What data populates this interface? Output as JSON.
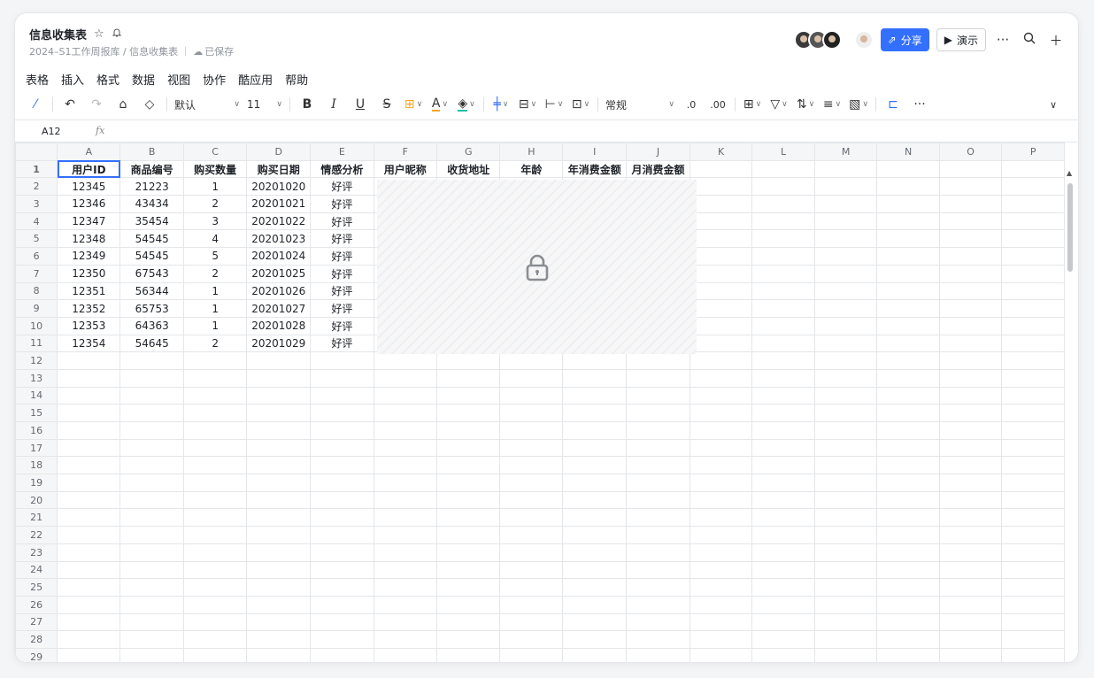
{
  "doc": {
    "title": "信息收集表",
    "breadcrumb": "2024–S1工作周报库 / 信息收集表",
    "save_status": "已保存"
  },
  "header": {
    "share_label": "分享",
    "demo_label": "演示",
    "more": "···"
  },
  "menu": [
    "表格",
    "插入",
    "格式",
    "数据",
    "视图",
    "协作",
    "酷应用",
    "帮助"
  ],
  "toolbar": {
    "font": "默认",
    "size": "11",
    "format": "常规",
    "more": "···"
  },
  "formula": {
    "cell_ref": "A12",
    "fx": "fx"
  },
  "columns": [
    "A",
    "B",
    "C",
    "D",
    "E",
    "F",
    "G",
    "H",
    "I",
    "J",
    "K",
    "L",
    "M",
    "N",
    "O",
    "P"
  ],
  "headers": [
    "用户ID",
    "商品编号",
    "购买数量",
    "购买日期",
    "情感分析",
    "用户昵称",
    "收货地址",
    "年龄",
    "年消费金额",
    "月消费金额"
  ],
  "rows": [
    [
      "12345",
      "21223",
      "1",
      "20201020",
      "好评"
    ],
    [
      "12346",
      "43434",
      "2",
      "20201021",
      "好评"
    ],
    [
      "12347",
      "35454",
      "3",
      "20201022",
      "好评"
    ],
    [
      "12348",
      "54545",
      "4",
      "20201023",
      "好评"
    ],
    [
      "12349",
      "54545",
      "5",
      "20201024",
      "好评"
    ],
    [
      "12350",
      "67543",
      "2",
      "20201025",
      "好评"
    ],
    [
      "12351",
      "56344",
      "1",
      "20201026",
      "好评"
    ],
    [
      "12352",
      "65753",
      "1",
      "20201027",
      "好评"
    ],
    [
      "12353",
      "64363",
      "1",
      "20201028",
      "好评"
    ],
    [
      "12354",
      "54645",
      "2",
      "20201029",
      "好评"
    ]
  ],
  "row_count": 30,
  "colors": {
    "accent": "#3370ff"
  }
}
